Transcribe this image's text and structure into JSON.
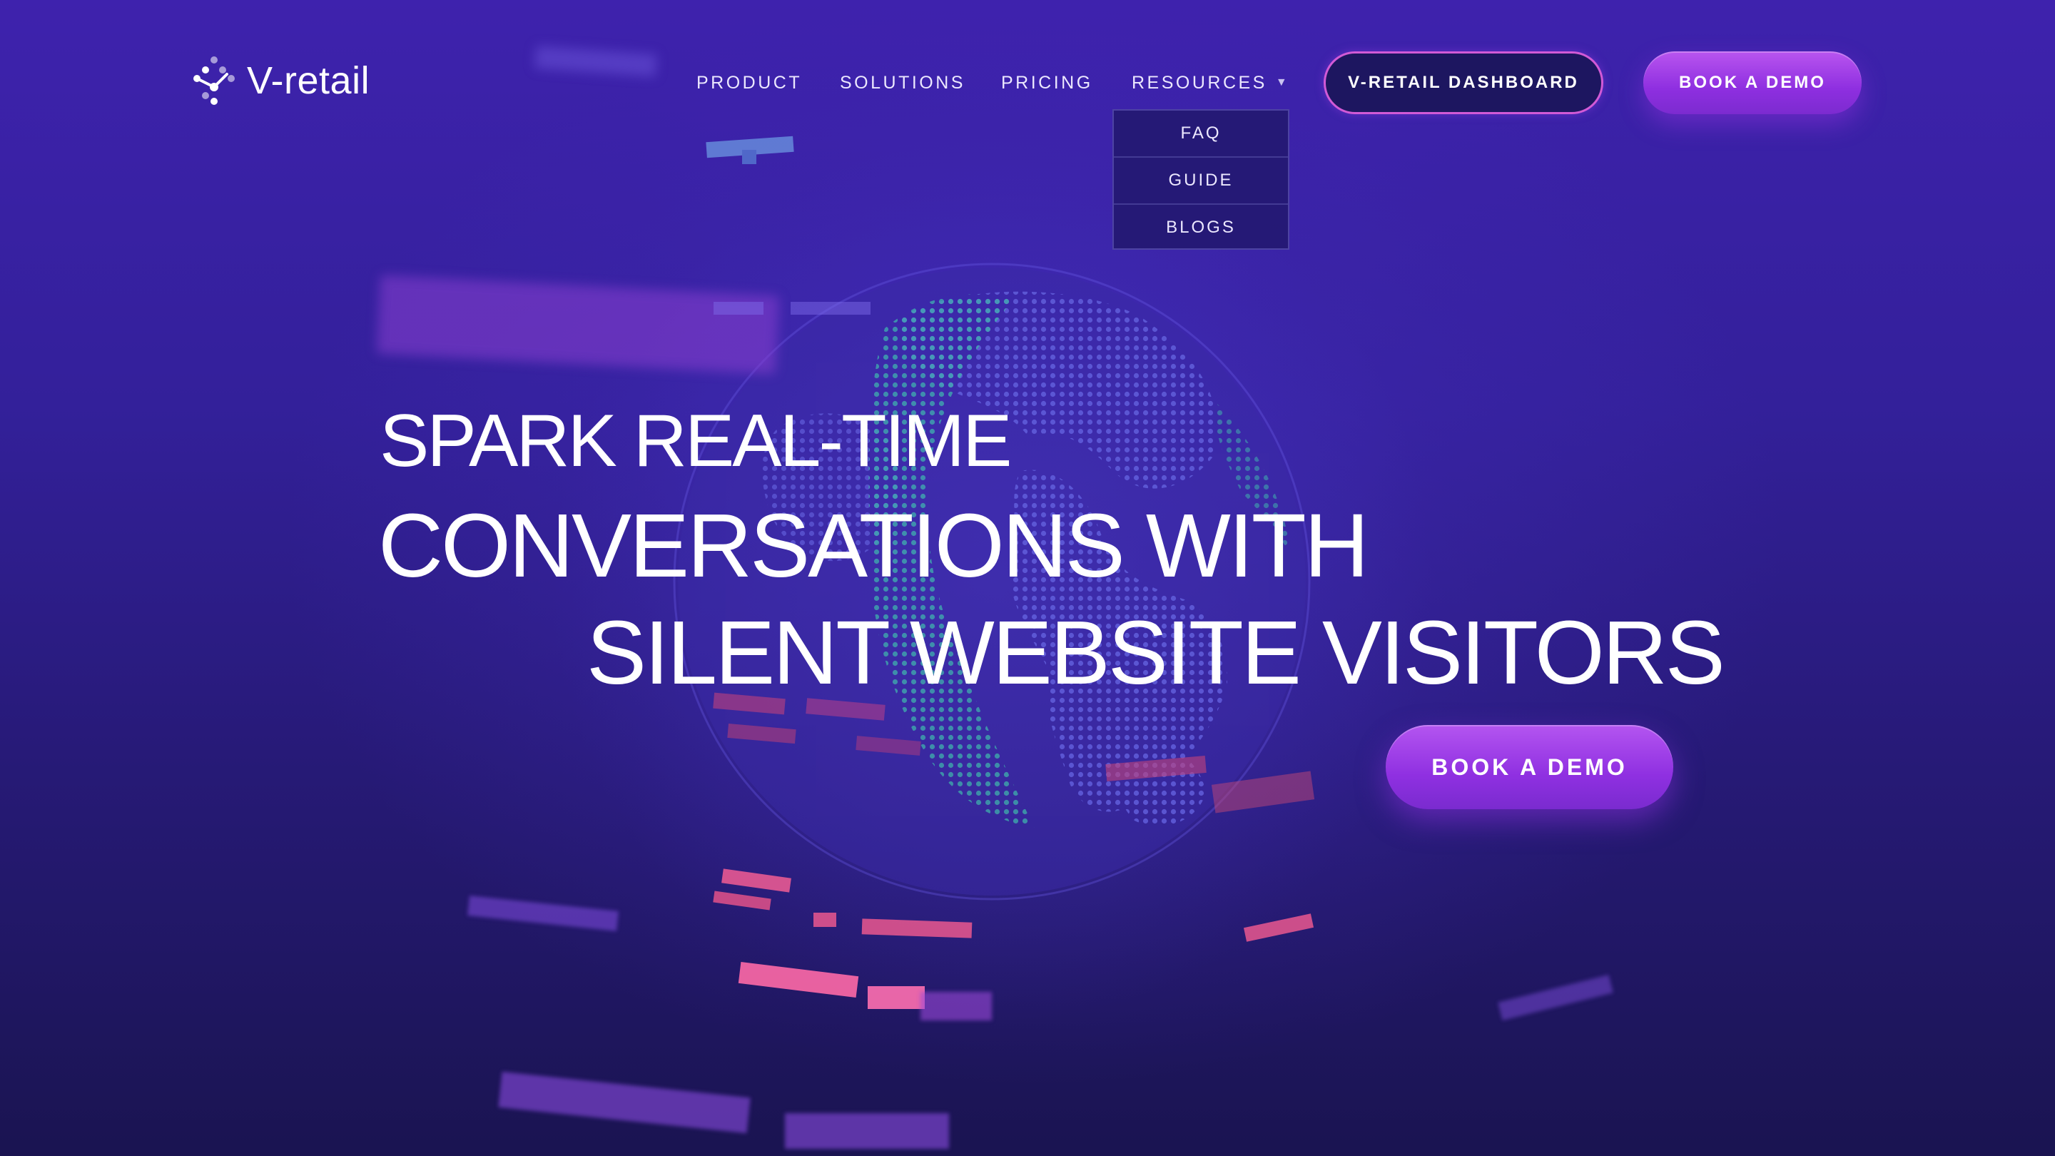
{
  "brand": {
    "name": "V-retail",
    "logo_icon": "network-dots-icon"
  },
  "nav": {
    "items": [
      {
        "label": "PRODUCT"
      },
      {
        "label": "SOLUTIONS"
      },
      {
        "label": "PRICING"
      },
      {
        "label": "RESOURCES",
        "has_dropdown": true
      }
    ],
    "resources_dropdown": [
      {
        "label": "FAQ"
      },
      {
        "label": "GUIDE"
      },
      {
        "label": "BLOGS"
      }
    ],
    "dashboard_button": "V-RETAIL DASHBOARD",
    "demo_button": "BOOK A DEMO"
  },
  "hero": {
    "line1": "SPARK REAL-TIME",
    "line2": "CONVERSATIONS WITH",
    "line3": "SILENT WEBSITE VISITORS",
    "cta": "BOOK A DEMO"
  },
  "colors": {
    "background_top": "#3e22ad",
    "background_bottom": "#1a1451",
    "button_gradient_start": "#b955ef",
    "button_gradient_end": "#7c2bd0",
    "dashboard_border": "#d25ad6",
    "globe_land": "#3fbfae"
  }
}
